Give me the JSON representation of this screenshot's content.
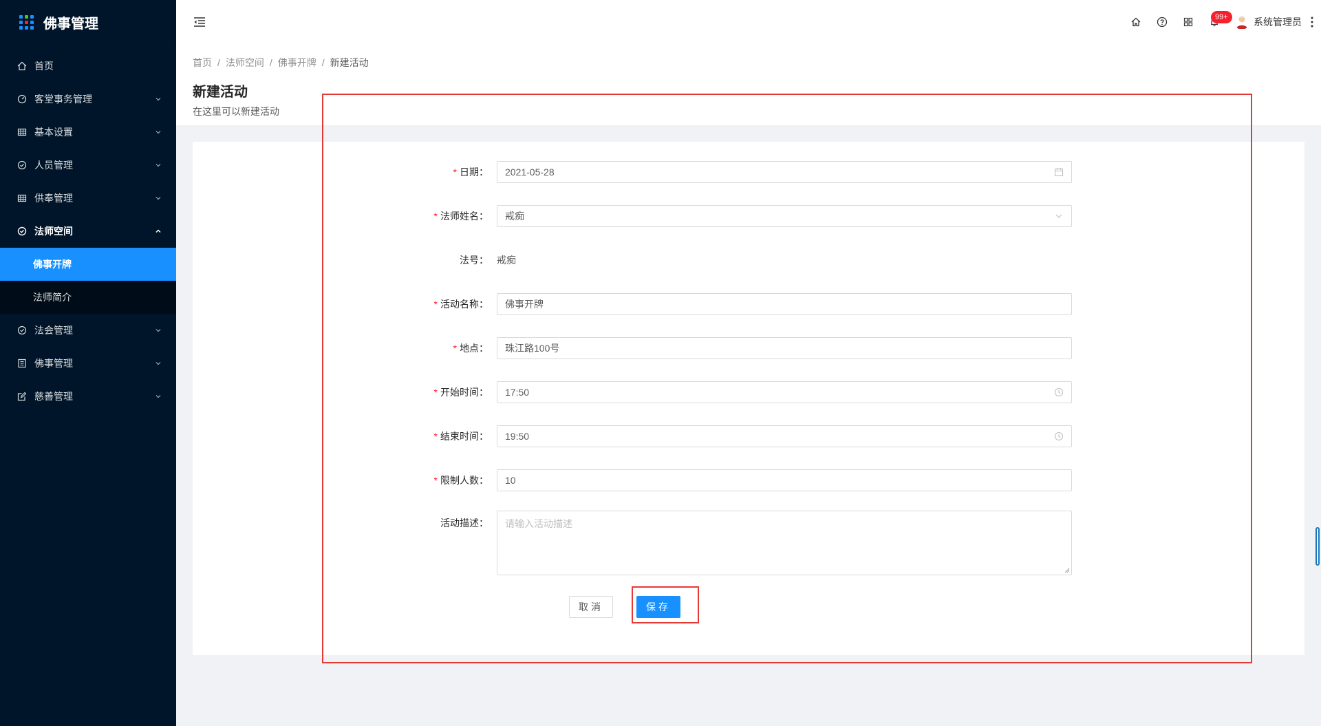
{
  "app": {
    "title": "佛事管理"
  },
  "sidebar": {
    "items": [
      {
        "label": "首页",
        "icon": "home-icon"
      },
      {
        "label": "客堂事务管理",
        "icon": "dashboard-icon"
      },
      {
        "label": "基本设置",
        "icon": "table-icon"
      },
      {
        "label": "人员管理",
        "icon": "check-circle-icon"
      },
      {
        "label": "供奉管理",
        "icon": "table-icon"
      },
      {
        "label": "法师空间",
        "icon": "check-circle-icon"
      },
      {
        "label": "法会管理",
        "icon": "check-circle-icon"
      },
      {
        "label": "佛事管理",
        "icon": "profile-icon"
      },
      {
        "label": "慈善管理",
        "icon": "form-icon"
      }
    ],
    "submenu": [
      {
        "label": "佛事开牌"
      },
      {
        "label": "法师简介"
      }
    ]
  },
  "header": {
    "notification_badge": "99+",
    "username": "系统管理员"
  },
  "breadcrumb": {
    "items": [
      "首页",
      "法师空间",
      "佛事开牌"
    ],
    "current": "新建活动",
    "separator": "/"
  },
  "page": {
    "title": "新建活动",
    "description": "在这里可以新建活动"
  },
  "form": {
    "date": {
      "label": "日期",
      "value": "2021-05-28"
    },
    "master_name": {
      "label": "法师姓名",
      "value": "戒痴"
    },
    "dharma_name": {
      "label": "法号",
      "value": "戒痴"
    },
    "activity_name": {
      "label": "活动名称",
      "value": "佛事开牌"
    },
    "location": {
      "label": "地点",
      "value": "珠江路100号"
    },
    "start_time": {
      "label": "开始时间",
      "value": "17:50"
    },
    "end_time": {
      "label": "结束时间",
      "value": "19:50"
    },
    "limit": {
      "label": "限制人数",
      "value": "10"
    },
    "description": {
      "label": "活动描述",
      "placeholder": "请输入活动描述"
    },
    "colon": "：",
    "required_mark": "*",
    "cancel_label": "取消",
    "save_label": "保存"
  },
  "colors": {
    "sidebar_bg": "#001529",
    "primary": "#1890ff",
    "danger": "#f5222d",
    "annotation": "#e53935"
  }
}
